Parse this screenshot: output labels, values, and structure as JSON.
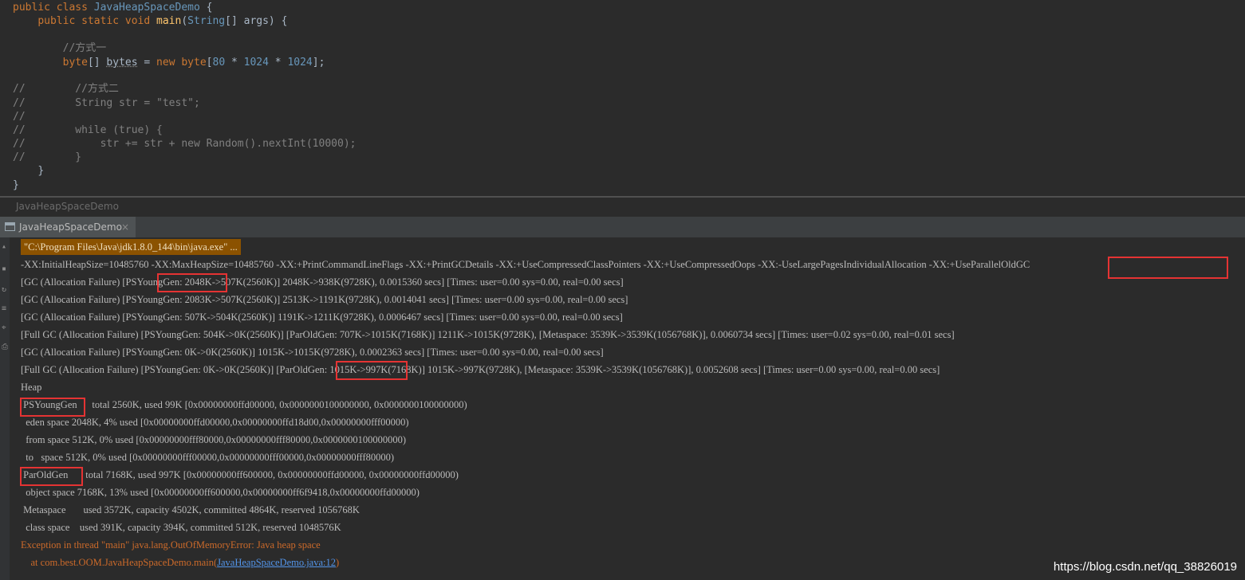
{
  "editor": {
    "lines": [
      {
        "indent": "",
        "parts": [
          {
            "t": "public class ",
            "c": "kw"
          },
          {
            "t": "JavaHeapSpaceDemo",
            "c": "cls"
          },
          {
            "t": " {",
            "c": "var"
          }
        ]
      },
      {
        "indent": "    ",
        "parts": [
          {
            "t": "public static void ",
            "c": "kw"
          },
          {
            "t": "main",
            "c": "fn"
          },
          {
            "t": "(",
            "c": "var"
          },
          {
            "t": "String",
            "c": "cls"
          },
          {
            "t": "[] args) {",
            "c": "var"
          }
        ]
      },
      {
        "indent": "",
        "parts": []
      },
      {
        "indent": "        ",
        "parts": [
          {
            "t": "//方式一",
            "c": "com"
          }
        ]
      },
      {
        "indent": "        ",
        "parts": [
          {
            "t": "byte",
            "c": "kw"
          },
          {
            "t": "[] ",
            "c": "var"
          },
          {
            "t": "bytes",
            "c": "fade"
          },
          {
            "t": " = ",
            "c": "var"
          },
          {
            "t": "new ",
            "c": "kw"
          },
          {
            "t": "byte",
            "c": "kw"
          },
          {
            "t": "[",
            "c": "var"
          },
          {
            "t": "80",
            "c": "num"
          },
          {
            "t": " * ",
            "c": "var"
          },
          {
            "t": "1024",
            "c": "num"
          },
          {
            "t": " * ",
            "c": "var"
          },
          {
            "t": "1024",
            "c": "num"
          },
          {
            "t": "];",
            "c": "var"
          }
        ]
      },
      {
        "indent": "",
        "parts": []
      },
      {
        "indent": "",
        "parts": [
          {
            "t": "//        //方式二",
            "c": "com"
          }
        ]
      },
      {
        "indent": "",
        "parts": [
          {
            "t": "//        String str = \"test\";",
            "c": "com"
          }
        ]
      },
      {
        "indent": "",
        "parts": [
          {
            "t": "//",
            "c": "com"
          }
        ]
      },
      {
        "indent": "",
        "parts": [
          {
            "t": "//        while (true) {",
            "c": "com"
          }
        ]
      },
      {
        "indent": "",
        "parts": [
          {
            "t": "//            str += str + new Random().nextInt(10000);",
            "c": "com"
          }
        ]
      },
      {
        "indent": "",
        "parts": [
          {
            "t": "//        }",
            "c": "com"
          }
        ]
      },
      {
        "indent": "    ",
        "parts": [
          {
            "t": "}",
            "c": "var"
          }
        ]
      },
      {
        "indent": "",
        "parts": [
          {
            "t": "}",
            "c": "var"
          }
        ]
      }
    ]
  },
  "breadcrumb": "JavaHeapSpaceDemo",
  "run_tab": {
    "label": "JavaHeapSpaceDemo",
    "close": "×"
  },
  "console": {
    "cmd": "\"C:\\Program Files\\Java\\jdk1.8.0_144\\bin\\java.exe\" ...",
    "lines": [
      "-XX:InitialHeapSize=10485760 -XX:MaxHeapSize=10485760 -XX:+PrintCommandLineFlags -XX:+PrintGCDetails -XX:+UseCompressedClassPointers -XX:+UseCompressedOops -XX:-UseLargePagesIndividualAllocation -XX:+UseParallelOldGC",
      "[GC (Allocation Failure) [PSYoungGen: 2048K->507K(2560K)] 2048K->938K(9728K), 0.0015360 secs] [Times: user=0.00 sys=0.00, real=0.00 secs]",
      "[GC (Allocation Failure) [PSYoungGen: 2083K->507K(2560K)] 2513K->1191K(9728K), 0.0014041 secs] [Times: user=0.00 sys=0.00, real=0.00 secs]",
      "[GC (Allocation Failure) [PSYoungGen: 507K->504K(2560K)] 1191K->1211K(9728K), 0.0006467 secs] [Times: user=0.00 sys=0.00, real=0.00 secs]",
      "[Full GC (Allocation Failure) [PSYoungGen: 504K->0K(2560K)] [ParOldGen: 707K->1015K(7168K)] 1211K->1015K(9728K), [Metaspace: 3539K->3539K(1056768K)], 0.0060734 secs] [Times: user=0.02 sys=0.00, real=0.01 secs]",
      "[GC (Allocation Failure) [PSYoungGen: 0K->0K(2560K)] 1015K->1015K(9728K), 0.0002363 secs] [Times: user=0.00 sys=0.00, real=0.00 secs]",
      "[Full GC (Allocation Failure) [PSYoungGen: 0K->0K(2560K)] [ParOldGen: 1015K->997K(7168K)] 1015K->997K(9728K), [Metaspace: 3539K->3539K(1056768K)], 0.0052608 secs] [Times: user=0.00 sys=0.00, real=0.00 secs]",
      "Heap",
      " PSYoungGen      total 2560K, used 99K [0x00000000ffd00000, 0x0000000100000000, 0x0000000100000000)",
      "  eden space 2048K, 4% used [0x00000000ffd00000,0x00000000ffd18d00,0x00000000fff00000)",
      "  from space 512K, 0% used [0x00000000fff80000,0x00000000fff80000,0x0000000100000000)",
      "  to   space 512K, 0% used [0x00000000fff00000,0x00000000fff00000,0x00000000fff80000)",
      " ParOldGen       total 7168K, used 997K [0x00000000ff600000, 0x00000000ffd00000, 0x00000000ffd00000)",
      "  object space 7168K, 13% used [0x00000000ff600000,0x00000000ff6f9418,0x00000000ffd00000)",
      " Metaspace       used 3572K, capacity 4502K, committed 4864K, reserved 1056768K",
      "  class space    used 391K, capacity 394K, committed 512K, reserved 1048576K"
    ],
    "exception": "Exception in thread \"main\" java.lang.OutOfMemoryError: Java heap space",
    "at_prefix": "    at com.best.OOM.JavaHeapSpaceDemo.main(",
    "at_link": "JavaHeapSpaceDemo.java:12",
    "at_suffix": ")"
  },
  "watermark": "https://blog.csdn.net/qq_38826019"
}
